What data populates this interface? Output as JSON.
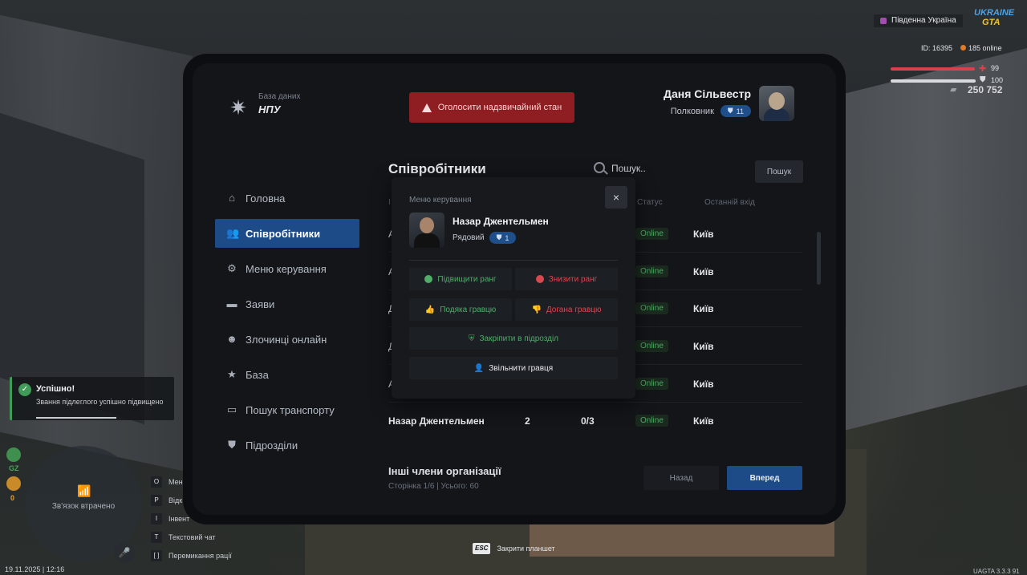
{
  "brand": {
    "subtitle": "База даних",
    "name": "НПУ"
  },
  "emergency_label": "Оголосити надзвичайний стан",
  "user": {
    "name": "Даня Сільвестр",
    "rank": "Полковник",
    "rank_level": "11"
  },
  "sidebar": {
    "items": [
      {
        "label": "Головна",
        "icon": "home-icon"
      },
      {
        "label": "Співробітники",
        "icon": "users-icon",
        "active": true
      },
      {
        "label": "Меню керування",
        "icon": "settings-icon"
      },
      {
        "label": "Заяви",
        "icon": "folder-icon"
      },
      {
        "label": "Злочинці онлайн",
        "icon": "mask-icon"
      },
      {
        "label": "База",
        "icon": "star-icon"
      },
      {
        "label": "Пошук транспорту",
        "icon": "car-icon"
      },
      {
        "label": "Підрозділи",
        "icon": "shield-icon"
      }
    ]
  },
  "main": {
    "title": "Співробітники",
    "search_placeholder": "Пошук..",
    "search_button": "Пошук",
    "headers": {
      "col1": "I",
      "status": "Статус",
      "last_login": "Останній вхід"
    },
    "rows": [
      {
        "name": "A",
        "status": "Online",
        "city": "Київ"
      },
      {
        "name": "A",
        "status": "Online",
        "city": "Київ"
      },
      {
        "name": "Д",
        "status": "Online",
        "city": "Київ"
      },
      {
        "name": "Д",
        "status": "Online",
        "city": "Київ"
      },
      {
        "name": "A",
        "status": "Online",
        "city": "Київ"
      },
      {
        "name": "Назар Джентельмен",
        "rank": "2",
        "warnings": "0/3",
        "status": "Online",
        "city": "Київ"
      }
    ],
    "other_title": "Інші члени організації",
    "page_info": "Сторінка 1/6 | Усього: 60",
    "back_button": "Назад",
    "next_button": "Вперед"
  },
  "modal": {
    "title": "Меню керування",
    "close": "×",
    "player_name": "Назар Джентельмен",
    "player_rank": "Рядовий",
    "player_rank_level": "1",
    "promote": "Підвищити ранг",
    "demote": "Знизити ранг",
    "thank": "Подяка гравцю",
    "reprimand": "Догана гравцю",
    "assign_unit": "Закріпити в підрозділ",
    "fire": "Звільнити гравця"
  },
  "hud": {
    "server": "Південна Україна",
    "logo_line1": "UKRAINE",
    "logo_line2": "GTA",
    "player_id": "ID: 16395",
    "online": "185 online",
    "health": "99",
    "armor": "100",
    "health_fraction": 0.99,
    "armor_fraction": 1.0,
    "money": "250 752",
    "colors": {
      "health": "#d9424b",
      "armor": "#d8dadf",
      "accent": "#1d4b87"
    }
  },
  "toast": {
    "title": "Успішно!",
    "text": "Звання підлеглого успішно підвищено"
  },
  "radar": {
    "status": "Зв'язок втрачено",
    "gz_label": "GZ",
    "gz_count": "0"
  },
  "keys": [
    {
      "key": "O",
      "label": "Мен"
    },
    {
      "key": "P",
      "label": "Відк"
    },
    {
      "key": "I",
      "label": "Інвент"
    },
    {
      "key": "T",
      "label": "Текстовий чат"
    },
    {
      "key": "[ ]",
      "label": "Перемикання рації"
    }
  ],
  "esc": {
    "key": "ESC",
    "label": "Закрити планшет"
  },
  "datetime": "19.11.2025 | 12:16",
  "version": "UAGTA 3.3.3   91"
}
